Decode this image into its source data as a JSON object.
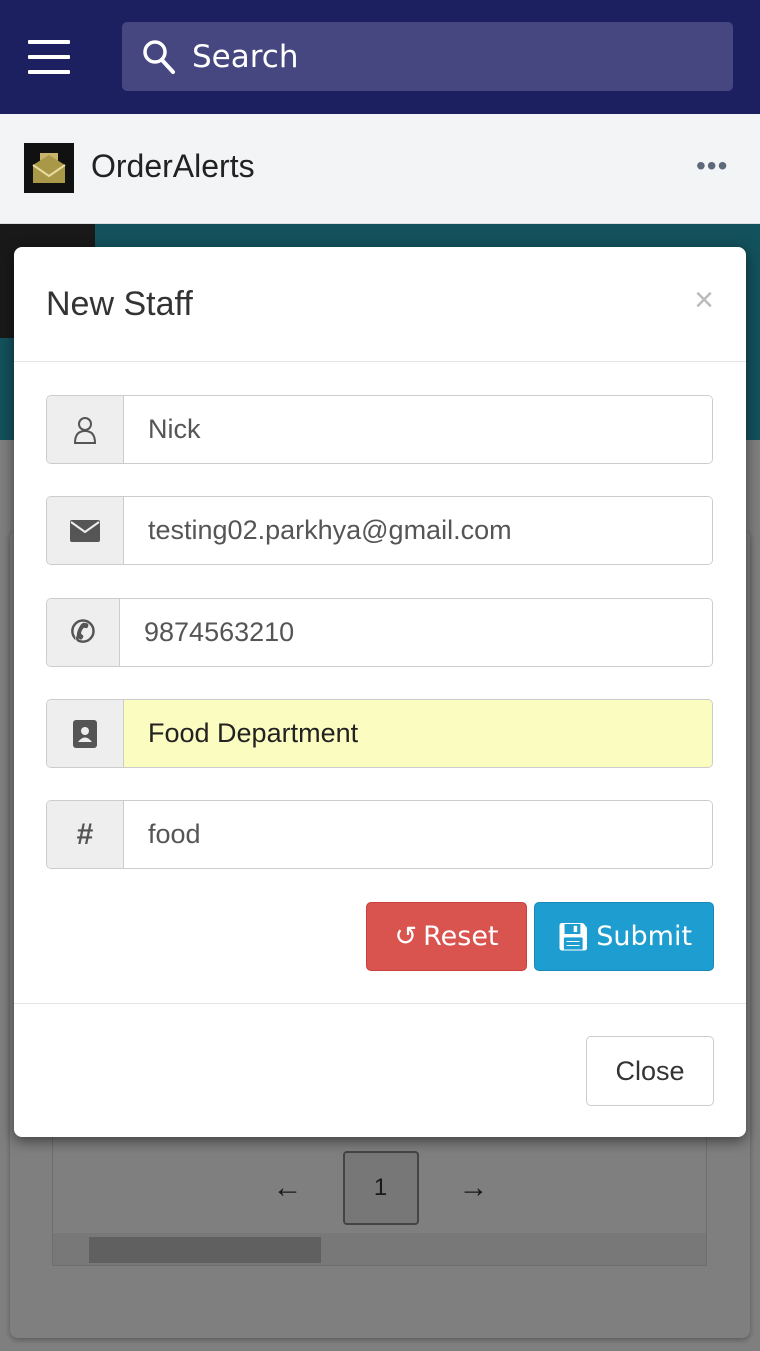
{
  "topbar": {
    "search_placeholder": "Search"
  },
  "appbar": {
    "title": "OrderAlerts",
    "more": "•••"
  },
  "background": {
    "pager": {
      "prev": "←",
      "page": "1",
      "next": "→"
    }
  },
  "modal": {
    "title": "New Staff",
    "close_x": "×",
    "fields": [
      {
        "icon": "user-icon",
        "value": "Nick"
      },
      {
        "icon": "envelope-icon",
        "value": "testing02.parkhya@gmail.com"
      },
      {
        "icon": "phone-icon",
        "value": "9874563210"
      },
      {
        "icon": "address-book-icon",
        "value": "Food Department"
      },
      {
        "icon": "hash-icon",
        "value": "food"
      }
    ],
    "reset_label": "Reset",
    "submit_label": "Submit",
    "close_label": "Close"
  },
  "colors": {
    "topbar": "#1d2060",
    "reset": "#d9534f",
    "submit": "#1e9dd0",
    "autofill": "#fafcc0"
  }
}
